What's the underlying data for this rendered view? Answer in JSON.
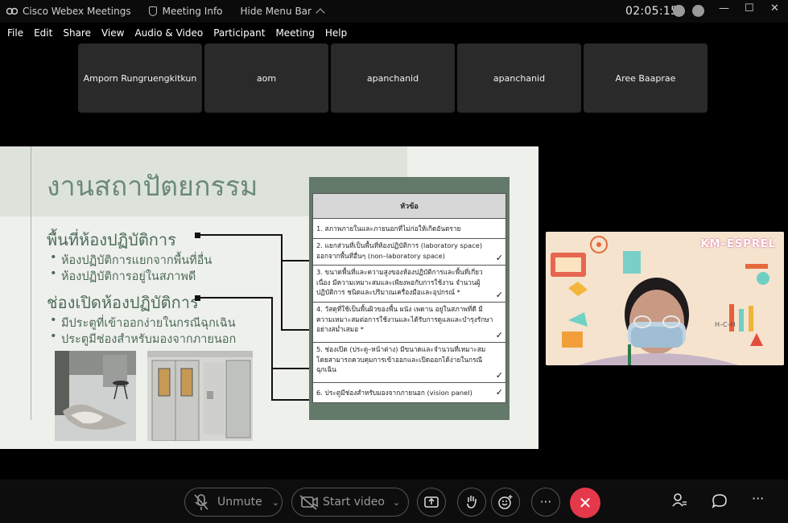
{
  "titlebar": {
    "app_name": "Cisco Webex Meetings",
    "meeting_info": "Meeting Info",
    "hide_menu": "Hide Menu Bar",
    "clock": "02:05:15"
  },
  "menu": [
    "File",
    "Edit",
    "Share",
    "View",
    "Audio & Video",
    "Participant",
    "Meeting",
    "Help"
  ],
  "participants": [
    "Amporn Rungruengkitkun",
    "aom",
    "apanchanid",
    "apanchanid",
    "Aree Baaprae"
  ],
  "slide": {
    "title": "งานสถาปัตยกรรม",
    "section1": "พื้นที่ห้องปฏิบัติการ",
    "bullets1": [
      "ห้องปฏิบัติการแยกจากพื้นที่อื่น",
      "ห้องปฏิบัติการอยู่ในสภาพดี"
    ],
    "section2": "ช่องเปิดห้องปฏิบัติการ",
    "bullets2": [
      "มีประตูที่เข้าออกง่ายในกรณีฉุกเฉิน",
      "ประตูมีช่องสำหรับมองจากภายนอก"
    ],
    "table_header": "หัวข้อ",
    "table_rows": [
      "1.  สภาพภายในและภายนอกที่ไม่ก่อให้เกิดอันตราย",
      "2.  แยกส่วนที่เป็นพื้นที่ห้องปฏิบัติการ (laboratory space) ออกจากพื้นที่อื่นๆ (non–laboratory space)",
      "3.  ขนาดพื้นที่และความสูงของห้องปฏิบัติการและพื้นที่เกี่ยวเนื่อง มีความเหมาะสมและเพียงพอกับการใช้งาน จำนวนผู้ปฏิบัติการ ชนิดและปริมาณเครื่องมือและอุปกรณ์ *",
      "4.  วัสดุที่ใช้เป็นพื้นผิวของพื้น ผนัง เพดาน อยู่ในสภาพที่ดี มีความเหมาะสมต่อการใช้งานและได้รับการดูแลและบำรุงรักษาอย่างสม่ำเสมอ *",
      "5.  ช่องเปิด (ประตู–หน้าต่าง) มีขนาดและจำนวนที่เหมาะสม โดยสามารถควบคุมการเข้าออกและเปิดออกได้ง่ายในกรณีฉุกเฉิน",
      "6.  ประตูมีช่องสำหรับมองจากภายนอก (vision panel)"
    ],
    "check": "✓"
  },
  "video": {
    "label": "KM–ESPREL"
  },
  "controls": {
    "unmute": "Unmute",
    "start_video": "Start video"
  }
}
